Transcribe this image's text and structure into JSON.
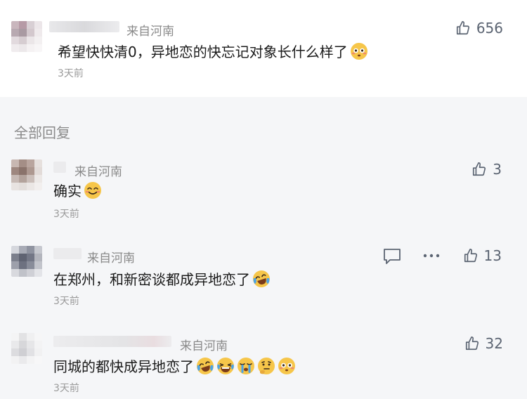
{
  "main_comment": {
    "location": "来自河南",
    "text": "希望快快清0，异地恋的快忘记对象长什么样了",
    "emojis": [
      "flushed-emoji"
    ],
    "time": "3天前",
    "likes": "656"
  },
  "section_title": "全部回复",
  "replies": [
    {
      "location": "来自河南",
      "text": "确实",
      "emojis": [
        "smile-emoji"
      ],
      "time": "3天前",
      "likes": "3"
    },
    {
      "location": "来自河南",
      "text": "在郑州，和新密谈都成异地恋了",
      "emojis": [
        "crying-laughing-emoji"
      ],
      "time": "3天前",
      "likes": "13"
    },
    {
      "location": "来自河南",
      "text": "同城的都快成异地恋了",
      "emojis": [
        "crying-laughing-emoji",
        "laughing-emoji",
        "sob-emoji",
        "thinking-emoji",
        "flushed-emoji"
      ],
      "time": "3天前",
      "likes": "32"
    }
  ],
  "colors": {
    "accent": "#5b6472",
    "muted": "#9a9a9a"
  }
}
